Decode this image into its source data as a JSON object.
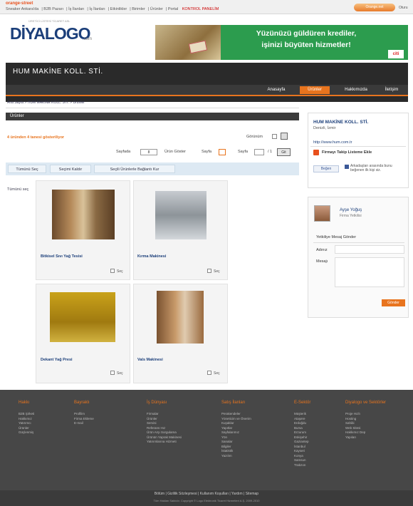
{
  "top": {
    "brand": "orange-street",
    "links": [
      "Sneaker Ankara'da",
      "B2B Pazarı",
      "İş İlanları",
      "İş İlanları",
      "Etkinlikler",
      "Birimler",
      "Ürünler",
      "Portal"
    ],
    "selected_link": "KONTROL PANELİM",
    "signin": "Orange.net",
    "exit": "Oturu"
  },
  "logo": {
    "tagline": "ÜRETİCİ LİSTESİ TİCARET ASL",
    "name": "DİYALOGO",
    "suffix": ".com"
  },
  "banner": {
    "line1": "Yüzünüzü güldüren krediler,",
    "line2": "işinizi büyüten hizmetler!",
    "logo": "citi"
  },
  "company": {
    "name": "HUM MAKİNE KOLL. STİ.",
    "nav": [
      "Anasayfa",
      "Ürünler",
      "Hakkımızda",
      "İletişim"
    ]
  },
  "breadcrumb": "Ana Sayfa  >  HUM MAKİNE KOLL. STİ.  >  Ürünler",
  "section_title": "Ürünler",
  "count_text": "4 üründen 4 tanesi gösteriliyor",
  "view_label": "Görünüm",
  "pagination": {
    "per_page": "Sayfada",
    "per_page_value": "8",
    "shown": "Ürün Göster",
    "page": "Sayfa",
    "page_label2": "Sayfa",
    "of": "/ 1",
    "go": "Git"
  },
  "actions": [
    "Tümünü Seç",
    "Seçimi Kaldır",
    "Seçili Ürünlerle Bağlantı Kur"
  ],
  "filters": "Tümünü seç",
  "products": [
    {
      "name": "Bitkisel Sıvı Yağ Tesisi",
      "compare": "Seç"
    },
    {
      "name": "Kırma Makinesi",
      "compare": "Seç"
    },
    {
      "name": "Dekant Yağ Presi",
      "compare": "Seç"
    },
    {
      "name": "Vals Makinesi",
      "compare": "Seç"
    }
  ],
  "right": {
    "name": "HUM MAKİNE KOLL. STİ.",
    "city": "Denizli, İzmir",
    "website": "http://www.hum.com.tr",
    "follow": "Firmayı Takip Listeme Ekle",
    "like": "Beğen",
    "fb_text": "Arkadaşları arasında bunu beğenen ilk kişi siz."
  },
  "contact": {
    "person": "Ayşe Yoğuş",
    "role": "Firma Yetkilisi",
    "title": "Yetkiliye Mesaj Gönder",
    "name_label": "Adınız",
    "msg_label": "Mesajı",
    "send": "Gönder"
  },
  "footer": {
    "columns": [
      {
        "title": "Hakkı",
        "items": [
          "B2B Şirketi",
          "Hakkımız",
          "Yatırımcı",
          "Ürünler",
          "Güçlenmiş"
        ]
      },
      {
        "title": "Bayraklı",
        "items": [
          "Profilim",
          "Firma Ekleme",
          "E-mail"
        ]
      },
      {
        "title": "İş Dünyası",
        "items": [
          "Firmalar",
          "Ürünler",
          "Servisi",
          "Referans Hız",
          "Ürün Arşı Sorgulama",
          "Ürünün Yaprak Makinesi",
          "Yatırımlarına Hizmeti"
        ]
      },
      {
        "title": "Satış İlanları",
        "items": [
          "Perakendeler",
          "Yöneticim ve Önerim",
          "Kuşaklar",
          "Yapıtlar",
          "Sayfalarımız",
          "Yön",
          "Sanalar",
          "Bilgiler",
          "İstatistik",
          "Yazılım"
        ]
      },
      {
        "title": "E-Sektör",
        "items": [
          "Müşterik",
          "Ataşere",
          "Erdoğdu",
          "Bursa",
          "Erzurum",
          "Eskişehir",
          "Gaziantep",
          "İstanbul",
          "Kayseri",
          "Konya",
          "Samsun",
          "Trabzon"
        ]
      },
      {
        "title": "Diyalogo ve Sektörler",
        "items": [
          "Proje Hızlı",
          "Hosting",
          "Sahibi",
          "Web Sitesi",
          "Hakkımız Dep",
          "Yapıları"
        ]
      }
    ],
    "links": "Bölüm  |  Gizlilik Sözleşmesi  |  Kullanım Koşulları  |  Yardım  |  Sitemap",
    "copyright": "Tüm Hakları Saklıdır. Copyright © Logo Elektronik Ticaret Hizmetleri A.Ş. 2009-2010"
  }
}
